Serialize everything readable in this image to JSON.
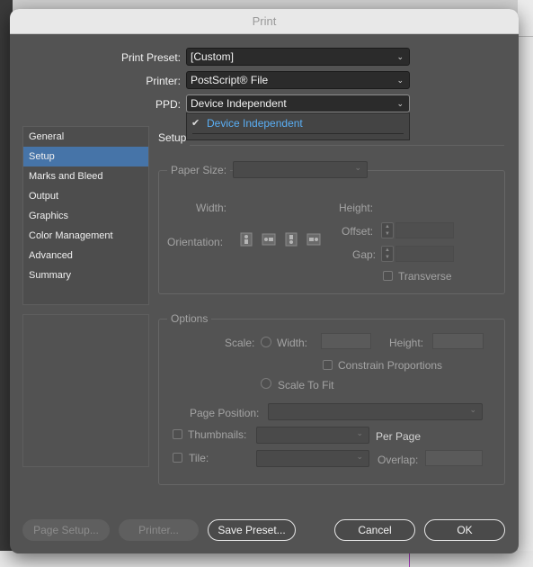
{
  "window": {
    "title": "Print"
  },
  "preset": {
    "label": "Print Preset:",
    "value": "[Custom]"
  },
  "printer": {
    "label": "Printer:",
    "value": "PostScript® File"
  },
  "ppd": {
    "label": "PPD:",
    "value": "Device Independent",
    "menu_option": "Device Independent"
  },
  "sidebar": {
    "items": [
      {
        "label": "General"
      },
      {
        "label": "Setup"
      },
      {
        "label": "Marks and Bleed"
      },
      {
        "label": "Output"
      },
      {
        "label": "Graphics"
      },
      {
        "label": "Color Management"
      },
      {
        "label": "Advanced"
      },
      {
        "label": "Summary"
      }
    ]
  },
  "setup": {
    "title": "Setup",
    "paper_size_label": "Paper Size:",
    "width_label": "Width:",
    "height_label": "Height:",
    "offset_label": "Offset:",
    "gap_label": "Gap:",
    "orientation_label": "Orientation:",
    "transverse_label": "Transverse",
    "orientation_icons": [
      "portrait-icon",
      "landscape-icon",
      "reverse-portrait-icon",
      "reverse-landscape-icon"
    ]
  },
  "options": {
    "title": "Options",
    "scale_label": "Scale:",
    "width_label": "Width:",
    "height_label": "Height:",
    "constrain_label": "Constrain Proportions",
    "scale_to_fit_label": "Scale To Fit",
    "page_position_label": "Page Position:",
    "thumbnails_label": "Thumbnails:",
    "per_page_label": "Per Page",
    "tile_label": "Tile:",
    "overlap_label": "Overlap:"
  },
  "buttons": {
    "page_setup": "Page Setup...",
    "printer": "Printer...",
    "save_preset": "Save Preset...",
    "cancel": "Cancel",
    "ok": "OK"
  },
  "colors": {
    "dialog_bg": "#535353",
    "selection": "#4674a8",
    "menu_highlight_text": "#5aaff5"
  }
}
